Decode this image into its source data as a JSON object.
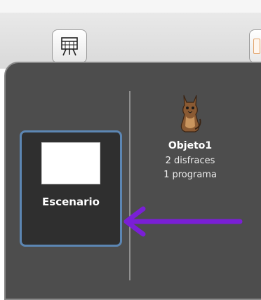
{
  "toolbar": {
    "buttons": [
      {
        "icon": "presentation-icon"
      },
      {
        "icon": "paint-icon"
      }
    ]
  },
  "stage": {
    "label": "Escenario",
    "thumbnail_color": "#ffffff"
  },
  "sprite": {
    "name": "Objeto1",
    "costumes": "2 disfraces",
    "scripts": "1 programa",
    "icon": "cat-sprite-icon"
  },
  "annotation": {
    "icon": "left-arrow-icon",
    "color": "#7a1fd6"
  }
}
